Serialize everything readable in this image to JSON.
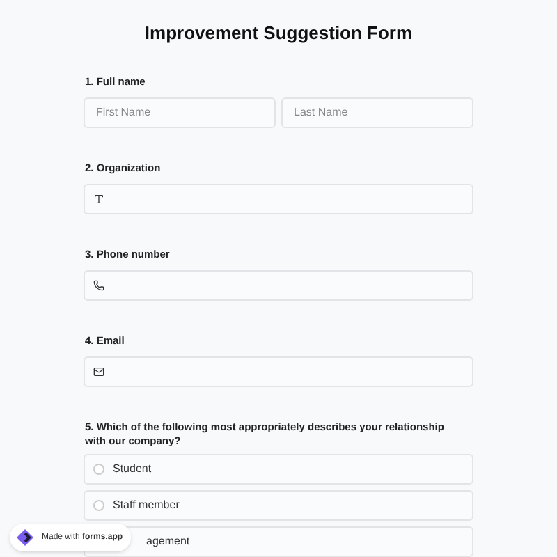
{
  "title": "Improvement Suggestion Form",
  "questions": [
    {
      "kind": "name",
      "label": "1.  Full name",
      "fields": [
        {
          "placeholder": "First Name"
        },
        {
          "placeholder": "Last Name"
        }
      ]
    },
    {
      "kind": "text",
      "label": "2. Organization"
    },
    {
      "kind": "phone",
      "label": "3. Phone number"
    },
    {
      "kind": "email",
      "label": "4. Email"
    },
    {
      "kind": "choice",
      "label": "5. Which of the following most appropriately describes your relationship with our company?",
      "options": [
        {
          "label": "Student",
          "selected": false
        },
        {
          "label": "Staff member",
          "selected": false
        },
        {
          "label": "agement",
          "selected": false,
          "covered": true
        }
      ]
    }
  ],
  "badge": "Made with **forms.app**"
}
